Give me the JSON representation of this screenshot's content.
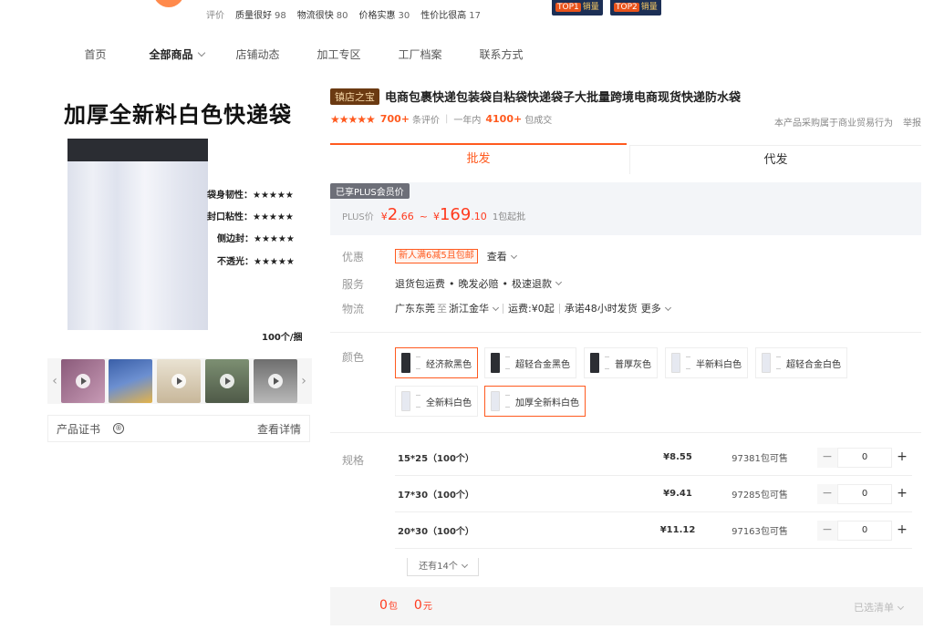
{
  "shop": {
    "rating_label": "评价",
    "tags": [
      {
        "name": "质量很好",
        "count": "98"
      },
      {
        "name": "物流很快",
        "count": "80"
      },
      {
        "name": "价格实惠",
        "count": "30"
      },
      {
        "name": "性价比很高",
        "count": "17"
      }
    ],
    "badges": [
      {
        "rank": "TOP1",
        "text": "销量"
      },
      {
        "rank": "TOP2",
        "text": "销量"
      }
    ]
  },
  "nav": {
    "items": [
      "首页",
      "全部商品",
      "店铺动态",
      "加工专区",
      "工厂档案",
      "联系方式"
    ]
  },
  "gallery": {
    "headline": "加厚全新料白色快递袋",
    "features": [
      "袋身韧性：★★★★★",
      "封口粘性：★★★★★",
      "侧边封：★★★★★",
      "不透光：★★★★★"
    ],
    "qty": "100个/捆",
    "prev": "‹",
    "next": "›",
    "cert_label": "产品证书",
    "cert_link": "查看详情"
  },
  "product": {
    "badge": "镇店之宝",
    "title": "电商包裹快递包装袋自粘袋快递袋子大批量跨境电商现货快递防水袋",
    "stars": "★★★★★",
    "reviews_count": "700+",
    "reviews_label": "条评价",
    "year_label": "一年内",
    "deals_count": "4100+",
    "deals_label": "包成交",
    "note": "本产品采购属于商业贸易行为",
    "report": "举报"
  },
  "tabs": {
    "wholesale": "批发",
    "dropship": "代发"
  },
  "price": {
    "plus_tag": "已享PLUS会员价",
    "label": "PLUS价",
    "currency": "¥",
    "min_int": "2",
    "min_dec": ".66",
    "tilde": "~",
    "max_int": "169",
    "max_dec": ".10",
    "moq": "1包起批"
  },
  "info": {
    "promo_label": "优惠",
    "promo_tag": "新人满6减5且包邮",
    "promo_view": "查看",
    "service_label": "服务",
    "services": [
      "退货包运费",
      "晚发必赔",
      "极速退款"
    ],
    "dot": "•",
    "logistics_label": "物流",
    "from": "广东东莞",
    "to_word": "至",
    "to": "浙江金华",
    "freight": "运费:¥0起",
    "promise": "承诺48小时发货",
    "more": "更多"
  },
  "colors": {
    "label": "颜色",
    "options": [
      {
        "name": "经济款黑色",
        "tone": "dark",
        "selected": true
      },
      {
        "name": "超轻合金黑色",
        "tone": "dark",
        "selected": false
      },
      {
        "name": "普厚灰色",
        "tone": "dark",
        "selected": false
      },
      {
        "name": "半新料白色",
        "tone": "light",
        "selected": false
      },
      {
        "name": "超轻合金白色",
        "tone": "light",
        "selected": false
      },
      {
        "name": "全新料白色",
        "tone": "light",
        "selected": false
      },
      {
        "name": "加厚全新料白色",
        "tone": "light",
        "selected": true
      }
    ]
  },
  "specs": {
    "label": "规格",
    "rows": [
      {
        "name": "15*25（100个）",
        "price": "¥8.55",
        "stock": "97381包可售",
        "qty": "0"
      },
      {
        "name": "17*30（100个）",
        "price": "¥9.41",
        "stock": "97285包可售",
        "qty": "0"
      },
      {
        "name": "20*30（100个）",
        "price": "¥11.12",
        "stock": "97163包可售",
        "qty": "0"
      }
    ],
    "minus": "−",
    "plus": "+",
    "more": "还有14个"
  },
  "footer": {
    "count": "0",
    "count_unit": "包",
    "amount": "0",
    "amount_unit": "元",
    "list": "已选清单"
  },
  "colors_theme": {
    "accent": "#ff5a1f",
    "price": "#ff3b1f"
  }
}
